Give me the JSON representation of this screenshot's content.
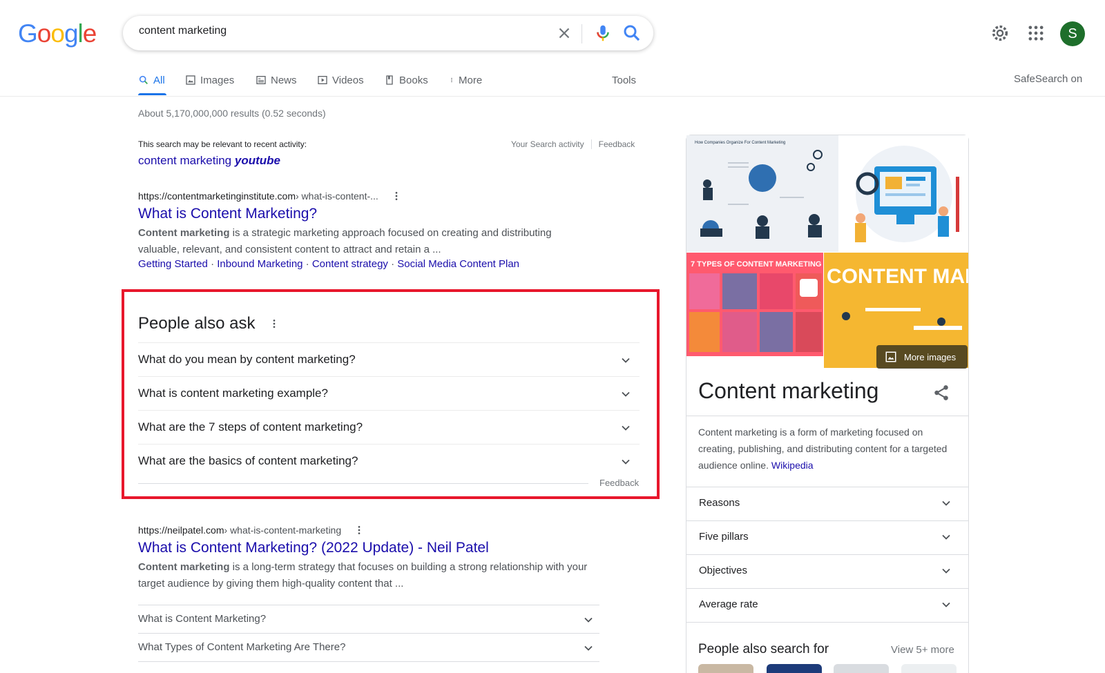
{
  "header": {
    "logo": "Google",
    "search_query": "content marketing",
    "avatar_letter": "S"
  },
  "tabs": {
    "all": "All",
    "images": "Images",
    "news": "News",
    "videos": "Videos",
    "books": "Books",
    "more": "More",
    "tools": "Tools",
    "safesearch": "SafeSearch on"
  },
  "stats": "About 5,170,000,000 results (0.52 seconds)",
  "recent": {
    "label": "This search may be relevant to recent activity:",
    "activity_link": "Your Search activity",
    "feedback": "Feedback",
    "suggest_prefix": "content marketing ",
    "suggest_bold": "youtube"
  },
  "result1": {
    "domain": "https://contentmarketinginstitute.com",
    "path": " › what-is-content-...",
    "title": "What is Content Marketing?",
    "snippet_bold": "Content marketing",
    "snippet_rest": " is a strategic marketing approach focused on creating and distributing valuable, relevant, and consistent content to attract and retain a ...",
    "sitelinks": [
      "Getting Started",
      "Inbound Marketing",
      "Content strategy",
      "Social Media Content Plan"
    ]
  },
  "paa": {
    "title": "People also ask",
    "questions": [
      "What do you mean by content marketing?",
      "What is content marketing example?",
      "What are the 7 steps of content marketing?",
      "What are the basics of content marketing?"
    ],
    "feedback": "Feedback"
  },
  "result2": {
    "domain": "https://neilpatel.com",
    "path": " › what-is-content-marketing",
    "title": "What is Content Marketing? (2022 Update) - Neil Patel",
    "snippet_bold": "Content marketing",
    "snippet_rest": " is a long-term strategy that focuses on building a strong relationship with your target audience by giving them high-quality content that ...",
    "faqs": [
      "What is Content Marketing?",
      "What Types of Content Marketing Are There?"
    ]
  },
  "knowledge_panel": {
    "images_caption": {
      "img1": "How Companies Organize For Content Marketing",
      "img3": "7 TYPES OF CONTENT MARKETING",
      "img4": "CONTENT MARKETING"
    },
    "more_images": "More images",
    "title": "Content marketing",
    "description": "Content marketing is a form of marketing focused on creating, publishing, and distributing content for a targeted audience online. ",
    "source_link": "Wikipedia",
    "rows": [
      "Reasons",
      "Five pillars",
      "Objectives",
      "Average rate"
    ],
    "people_also_search": "People also search for",
    "view_more": "View 5+ more"
  }
}
